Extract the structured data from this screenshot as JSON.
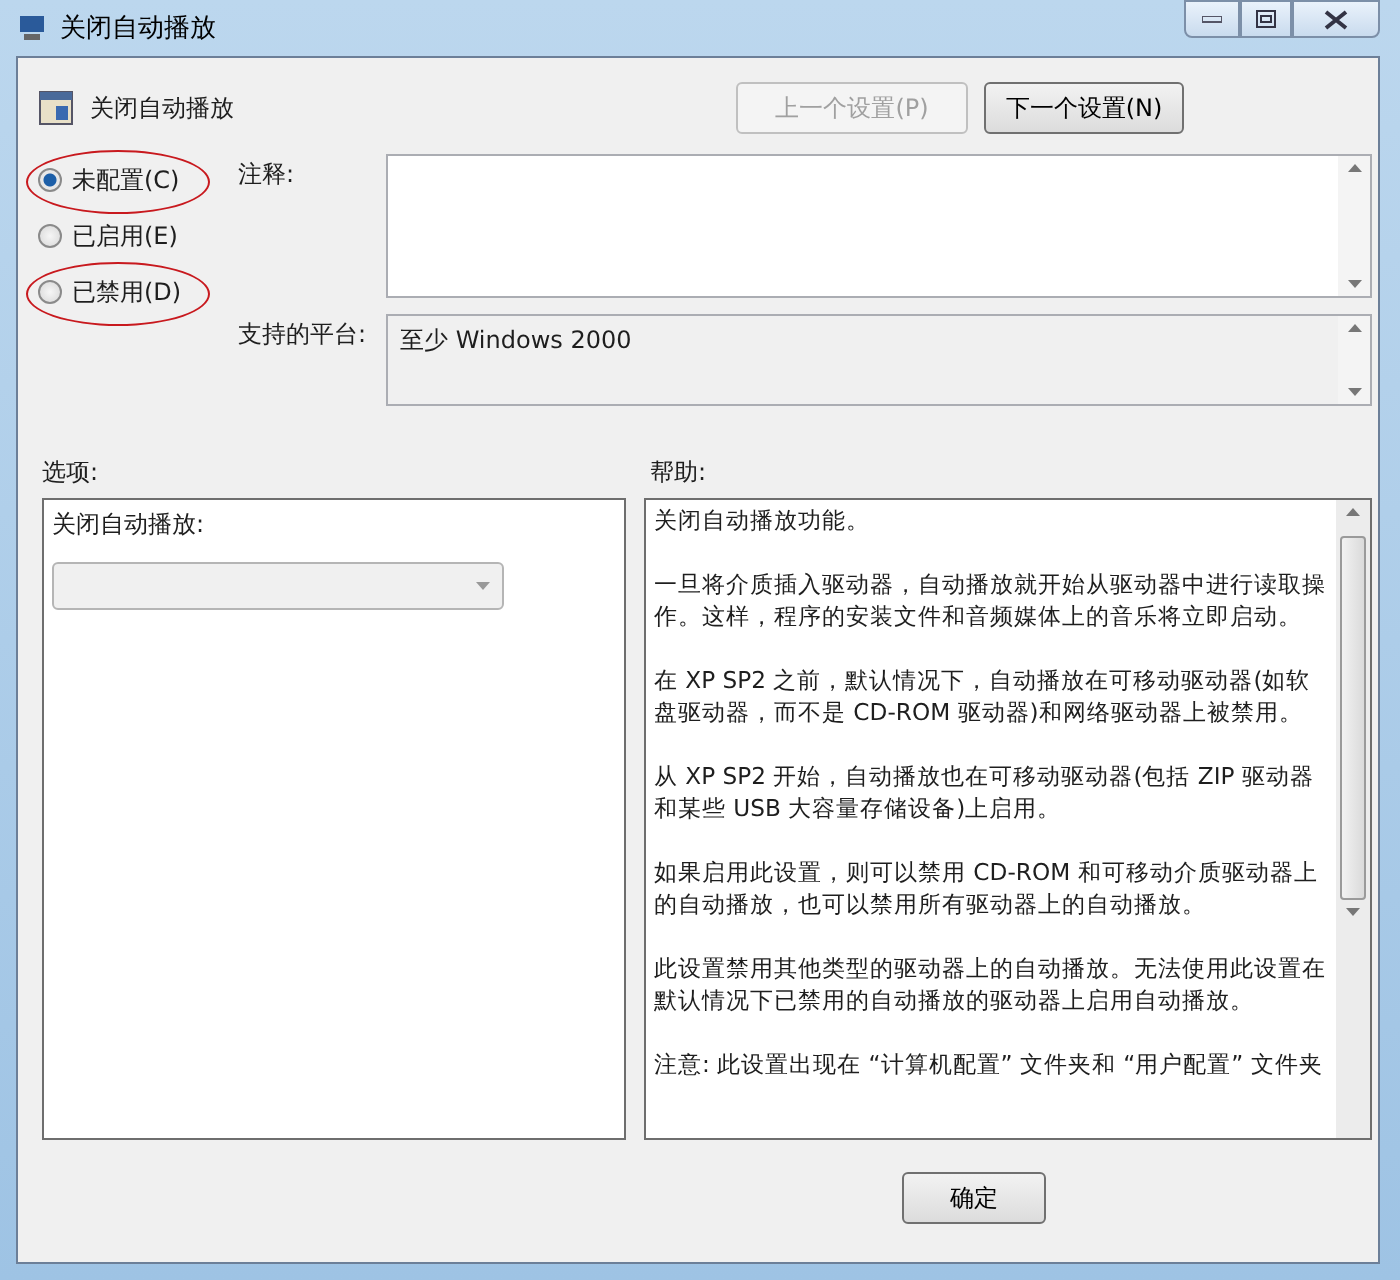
{
  "window": {
    "title": "关闭自动播放"
  },
  "header": {
    "title": "关闭自动播放"
  },
  "nav_buttons": [
    {
      "label": "上一个设置(P)",
      "disabled": true
    },
    {
      "label": "下一个设置(N)",
      "disabled": false
    }
  ],
  "states": [
    {
      "label": "未配置(C)",
      "selected": true,
      "annotated": true
    },
    {
      "label": "已启用(E)",
      "selected": false,
      "annotated": false
    },
    {
      "label": "已禁用(D)",
      "selected": false,
      "annotated": true
    }
  ],
  "comment": {
    "label": "注释:"
  },
  "platform": {
    "label": "支持的平台:",
    "value": "至少 Windows 2000"
  },
  "options": {
    "label": "选项:",
    "field_label": "关闭自动播放:",
    "dropdown_disabled": true
  },
  "help": {
    "label": "帮助:",
    "paragraphs": [
      "关闭自动播放功能。",
      "一旦将介质插入驱动器，自动播放就开始从驱动器中进行读取操作。这样，程序的安装文件和音频媒体上的音乐将立即启动。",
      "在 XP SP2 之前，默认情况下，自动播放在可移动驱动器(如软盘驱动器，而不是 CD-ROM 驱动器)和网络驱动器上被禁用。",
      "从 XP SP2 开始，自动播放也在可移动驱动器(包括 ZIP 驱动器和某些 USB 大容量存储设备)上启用。",
      "如果启用此设置，则可以禁用 CD-ROM 和可移动介质驱动器上的自动播放，也可以禁用所有驱动器上的自动播放。",
      "此设置禁用其他类型的驱动器上的自动播放。无法使用此设置在默认情况下已禁用的自动播放的驱动器上启用自动播放。",
      "注意: 此设置出现在 “计算机配置” 文件夹和 “用户配置” 文件夹"
    ]
  },
  "footer_buttons": [
    {
      "label": "确定"
    }
  ]
}
